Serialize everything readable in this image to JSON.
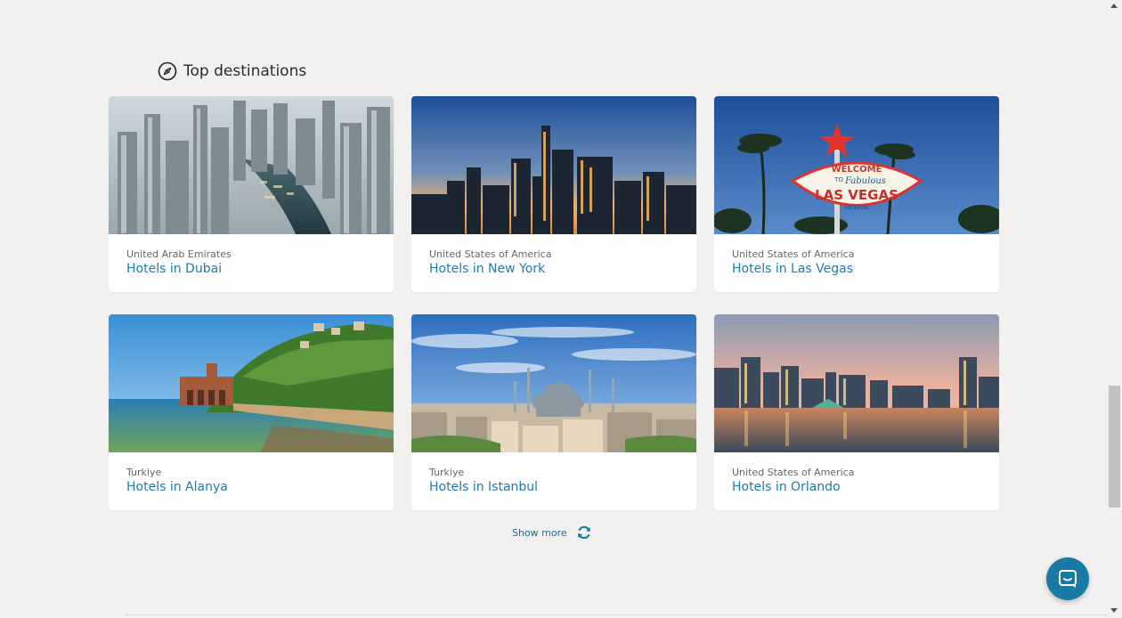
{
  "section": {
    "title": "Top destinations",
    "icon": "compass-icon"
  },
  "destinations": [
    {
      "country": "United Arab Emirates",
      "label": "Hotels in Dubai",
      "image": "dubai-marina-photo"
    },
    {
      "country": "United States of America",
      "label": "Hotels in New York",
      "image": "new-york-skyline-photo"
    },
    {
      "country": "United States of America",
      "label": "Hotels in Las Vegas",
      "image": "las-vegas-sign-photo",
      "sign": {
        "welcome": "WELCOME",
        "to": "TO",
        "fabulous": "Fabulous",
        "city": "LAS VEGAS",
        "state": "NEVADA"
      }
    },
    {
      "country": "Turkiye",
      "label": "Hotels in Alanya",
      "image": "alanya-castle-photo"
    },
    {
      "country": "Turkiye",
      "label": "Hotels in Istanbul",
      "image": "istanbul-mosque-photo"
    },
    {
      "country": "United States of America",
      "label": "Hotels in Orlando",
      "image": "orlando-lake-photo"
    }
  ],
  "show_more": {
    "label": "Show more",
    "icon": "refresh-icon"
  },
  "chat": {
    "icon": "chat-icon"
  },
  "colors": {
    "link": "#1c7ab4",
    "accent": "#1a7aa6",
    "background": "#f2f1ef"
  }
}
